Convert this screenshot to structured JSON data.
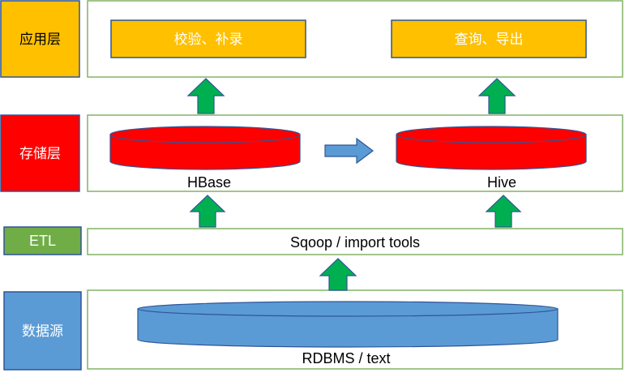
{
  "layers": {
    "application": {
      "label": "应用层",
      "color": "#FFC000"
    },
    "storage": {
      "label": "存储层",
      "color": "#FF0000"
    },
    "etl": {
      "label": "ETL",
      "color": "#70AD47"
    },
    "source": {
      "label": "数据源",
      "color": "#5B9BD5"
    }
  },
  "application_boxes": {
    "validate": "校验、补录",
    "query": "查询、导出"
  },
  "storage_items": {
    "hbase": "HBase",
    "hive": "Hive"
  },
  "etl_bar": {
    "label": "Sqoop / import tools"
  },
  "source_items": {
    "rdbms": "RDBMS / text"
  },
  "colors": {
    "frame_border": "#82B366",
    "arrow_green": "#00B050",
    "arrow_blue": "#5B9BD5",
    "cylinder_red": "#FF0000",
    "cylinder_blue": "#5B9BD5",
    "app_box_fill": "#FFC000"
  }
}
